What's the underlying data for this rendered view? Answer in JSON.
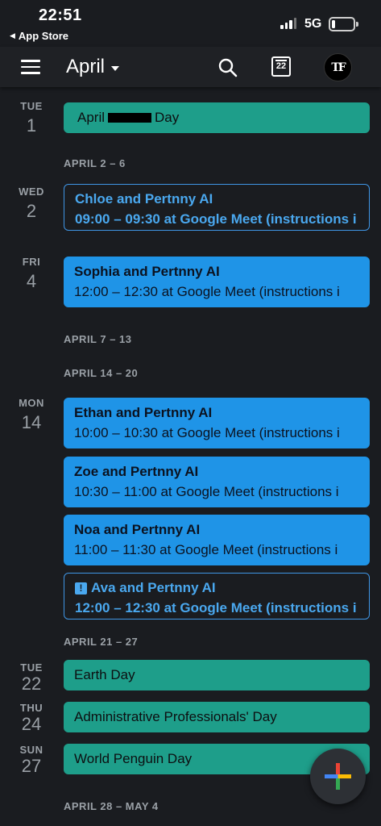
{
  "status": {
    "time": "22:51",
    "back_app": "App Store",
    "network": "5G",
    "battery_level": 0.15
  },
  "header": {
    "month": "April",
    "today_date": "22",
    "avatar_initials": "TF"
  },
  "agenda": {
    "week_2_6": "APRIL 2 – 6",
    "week_7_13": "APRIL 7 – 13",
    "week_14_20": "APRIL 14 – 20",
    "week_21_27": "APRIL 21 – 27",
    "week_28_4": "APRIL 28 – MAY 4",
    "days": {
      "tue1": {
        "dow": "TUE",
        "num": "1"
      },
      "wed2": {
        "dow": "WED",
        "num": "2"
      },
      "fri4": {
        "dow": "FRI",
        "num": "4"
      },
      "mon14": {
        "dow": "MON",
        "num": "14"
      },
      "tue22": {
        "dow": "TUE",
        "num": "22"
      },
      "thu24": {
        "dow": "THU",
        "num": "24"
      },
      "sun27": {
        "dow": "SUN",
        "num": "27"
      }
    },
    "events": {
      "april_day": {
        "title_start": "April",
        "title_end": "Day"
      },
      "chloe": {
        "title": "Chloe and Pertnny AI",
        "subtitle": "09:00 – 09:30 at Google Meet (instructions i"
      },
      "sophia": {
        "title": "Sophia and Pertnny AI",
        "subtitle": "12:00 – 12:30 at Google Meet (instructions i"
      },
      "ethan": {
        "title": "Ethan and Pertnny AI",
        "subtitle": "10:00 – 10:30 at Google Meet (instructions i"
      },
      "zoe": {
        "title": "Zoe and Pertnny AI",
        "subtitle": "10:30 – 11:00 at Google Meet (instructions i"
      },
      "noa": {
        "title": "Noa and Pertnny AI",
        "subtitle": "11:00 – 11:30 at Google Meet (instructions i"
      },
      "ava": {
        "title": "Ava and Pertnny AI",
        "subtitle": "12:00 – 12:30 at Google Meet (instructions i"
      },
      "earth": {
        "title": "Earth Day"
      },
      "admin": {
        "title": "Administrative Professionals' Day"
      },
      "penguin": {
        "title": "World Penguin Day"
      }
    }
  },
  "colors": {
    "background": "#1a1c20",
    "allday_event": "#1e9e8a",
    "meeting_event": "#1f94e7",
    "tentative_outline": "#3f95e4"
  },
  "icons": {
    "menu": "hamburger-menu-icon",
    "search": "search-icon",
    "today": "calendar-today-icon",
    "warning": "exclamation-icon",
    "create": "google-plus-icon"
  }
}
